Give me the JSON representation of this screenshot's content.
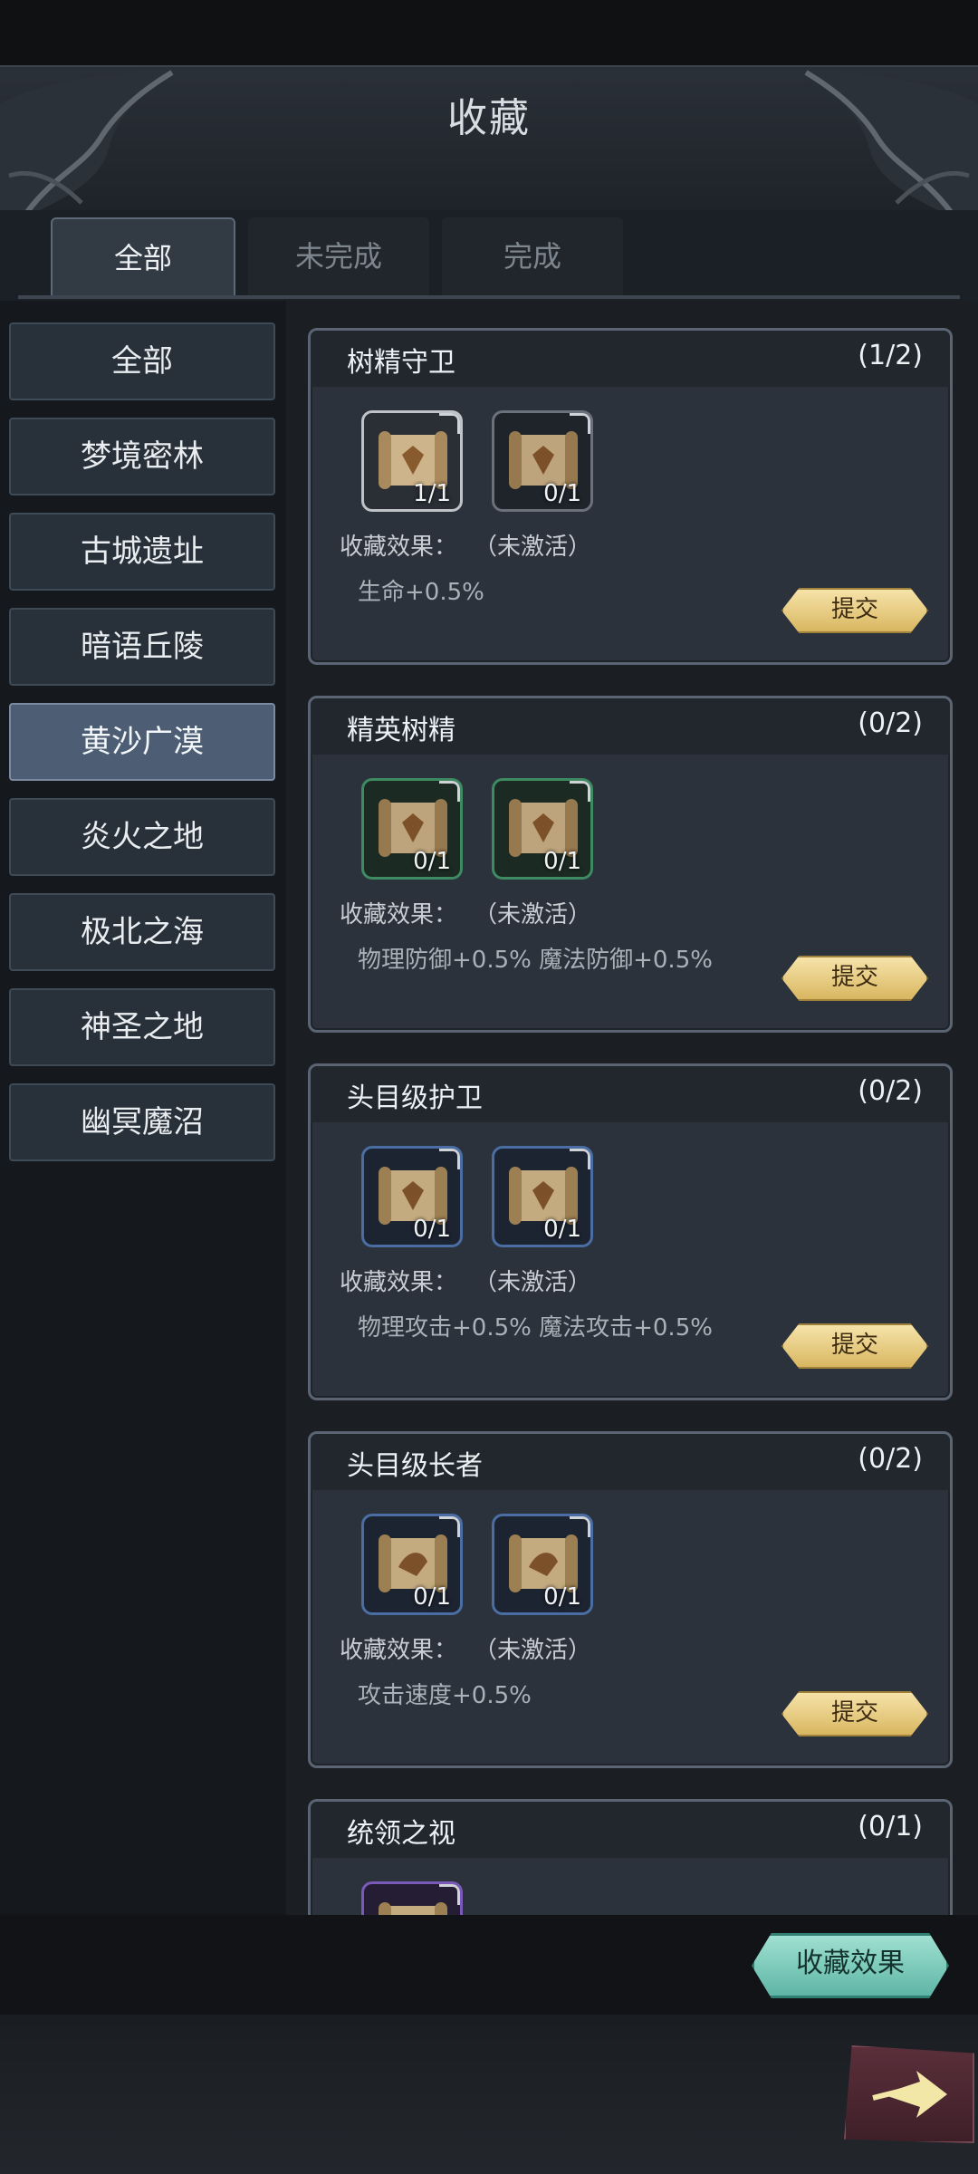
{
  "header": {
    "title": "收藏"
  },
  "tabs": [
    {
      "label": "全部",
      "active": true
    },
    {
      "label": "未完成",
      "active": false
    },
    {
      "label": "完成",
      "active": false
    }
  ],
  "sidebar": {
    "items": [
      {
        "label": "全部",
        "active": false
      },
      {
        "label": "梦境密林",
        "active": false
      },
      {
        "label": "古城遗址",
        "active": false
      },
      {
        "label": "暗语丘陵",
        "active": false
      },
      {
        "label": "黄沙广漠",
        "active": true
      },
      {
        "label": "炎火之地",
        "active": false
      },
      {
        "label": "极北之海",
        "active": false
      },
      {
        "label": "神圣之地",
        "active": false
      },
      {
        "label": "幽冥魔沼",
        "active": false
      }
    ]
  },
  "cards": [
    {
      "name": "树精守卫",
      "progress": "(1/2)",
      "items": [
        {
          "count": "1/1",
          "quality": "white"
        },
        {
          "count": "0/1",
          "quality": "gray"
        }
      ],
      "effect_label": "收藏效果：",
      "effect_status": "（未激活）",
      "effect_detail": "生命+0.5%",
      "submit_label": "提交"
    },
    {
      "name": "精英树精",
      "progress": "(0/2)",
      "items": [
        {
          "count": "0/1",
          "quality": "green"
        },
        {
          "count": "0/1",
          "quality": "green"
        }
      ],
      "effect_label": "收藏效果：",
      "effect_status": "（未激活）",
      "effect_detail": "物理防御+0.5% 魔法防御+0.5%",
      "submit_label": "提交"
    },
    {
      "name": "头目级护卫",
      "progress": "(0/2)",
      "items": [
        {
          "count": "0/1",
          "quality": "blue"
        },
        {
          "count": "0/1",
          "quality": "blue"
        }
      ],
      "effect_label": "收藏效果：",
      "effect_status": "（未激活）",
      "effect_detail": "物理攻击+0.5% 魔法攻击+0.5%",
      "submit_label": "提交"
    },
    {
      "name": "头目级长者",
      "progress": "(0/2)",
      "items": [
        {
          "count": "0/1",
          "quality": "blue"
        },
        {
          "count": "0/1",
          "quality": "blue"
        }
      ],
      "effect_label": "收藏效果：",
      "effect_status": "（未激活）",
      "effect_detail": "攻击速度+0.5%",
      "submit_label": "提交"
    },
    {
      "name": "统领之视",
      "progress": "(0/1)",
      "items": [
        {
          "count": "",
          "quality": "purple"
        }
      ],
      "effect_label": "",
      "effect_status": "",
      "effect_detail": "",
      "submit_label": ""
    }
  ],
  "bottom": {
    "effect_button": "收藏效果",
    "next_icon": "arrow-right-icon"
  },
  "colors": {
    "accent_gold": "#e6c878",
    "accent_teal": "#7dd0c1",
    "active_sidebar": "#4c5d74"
  }
}
